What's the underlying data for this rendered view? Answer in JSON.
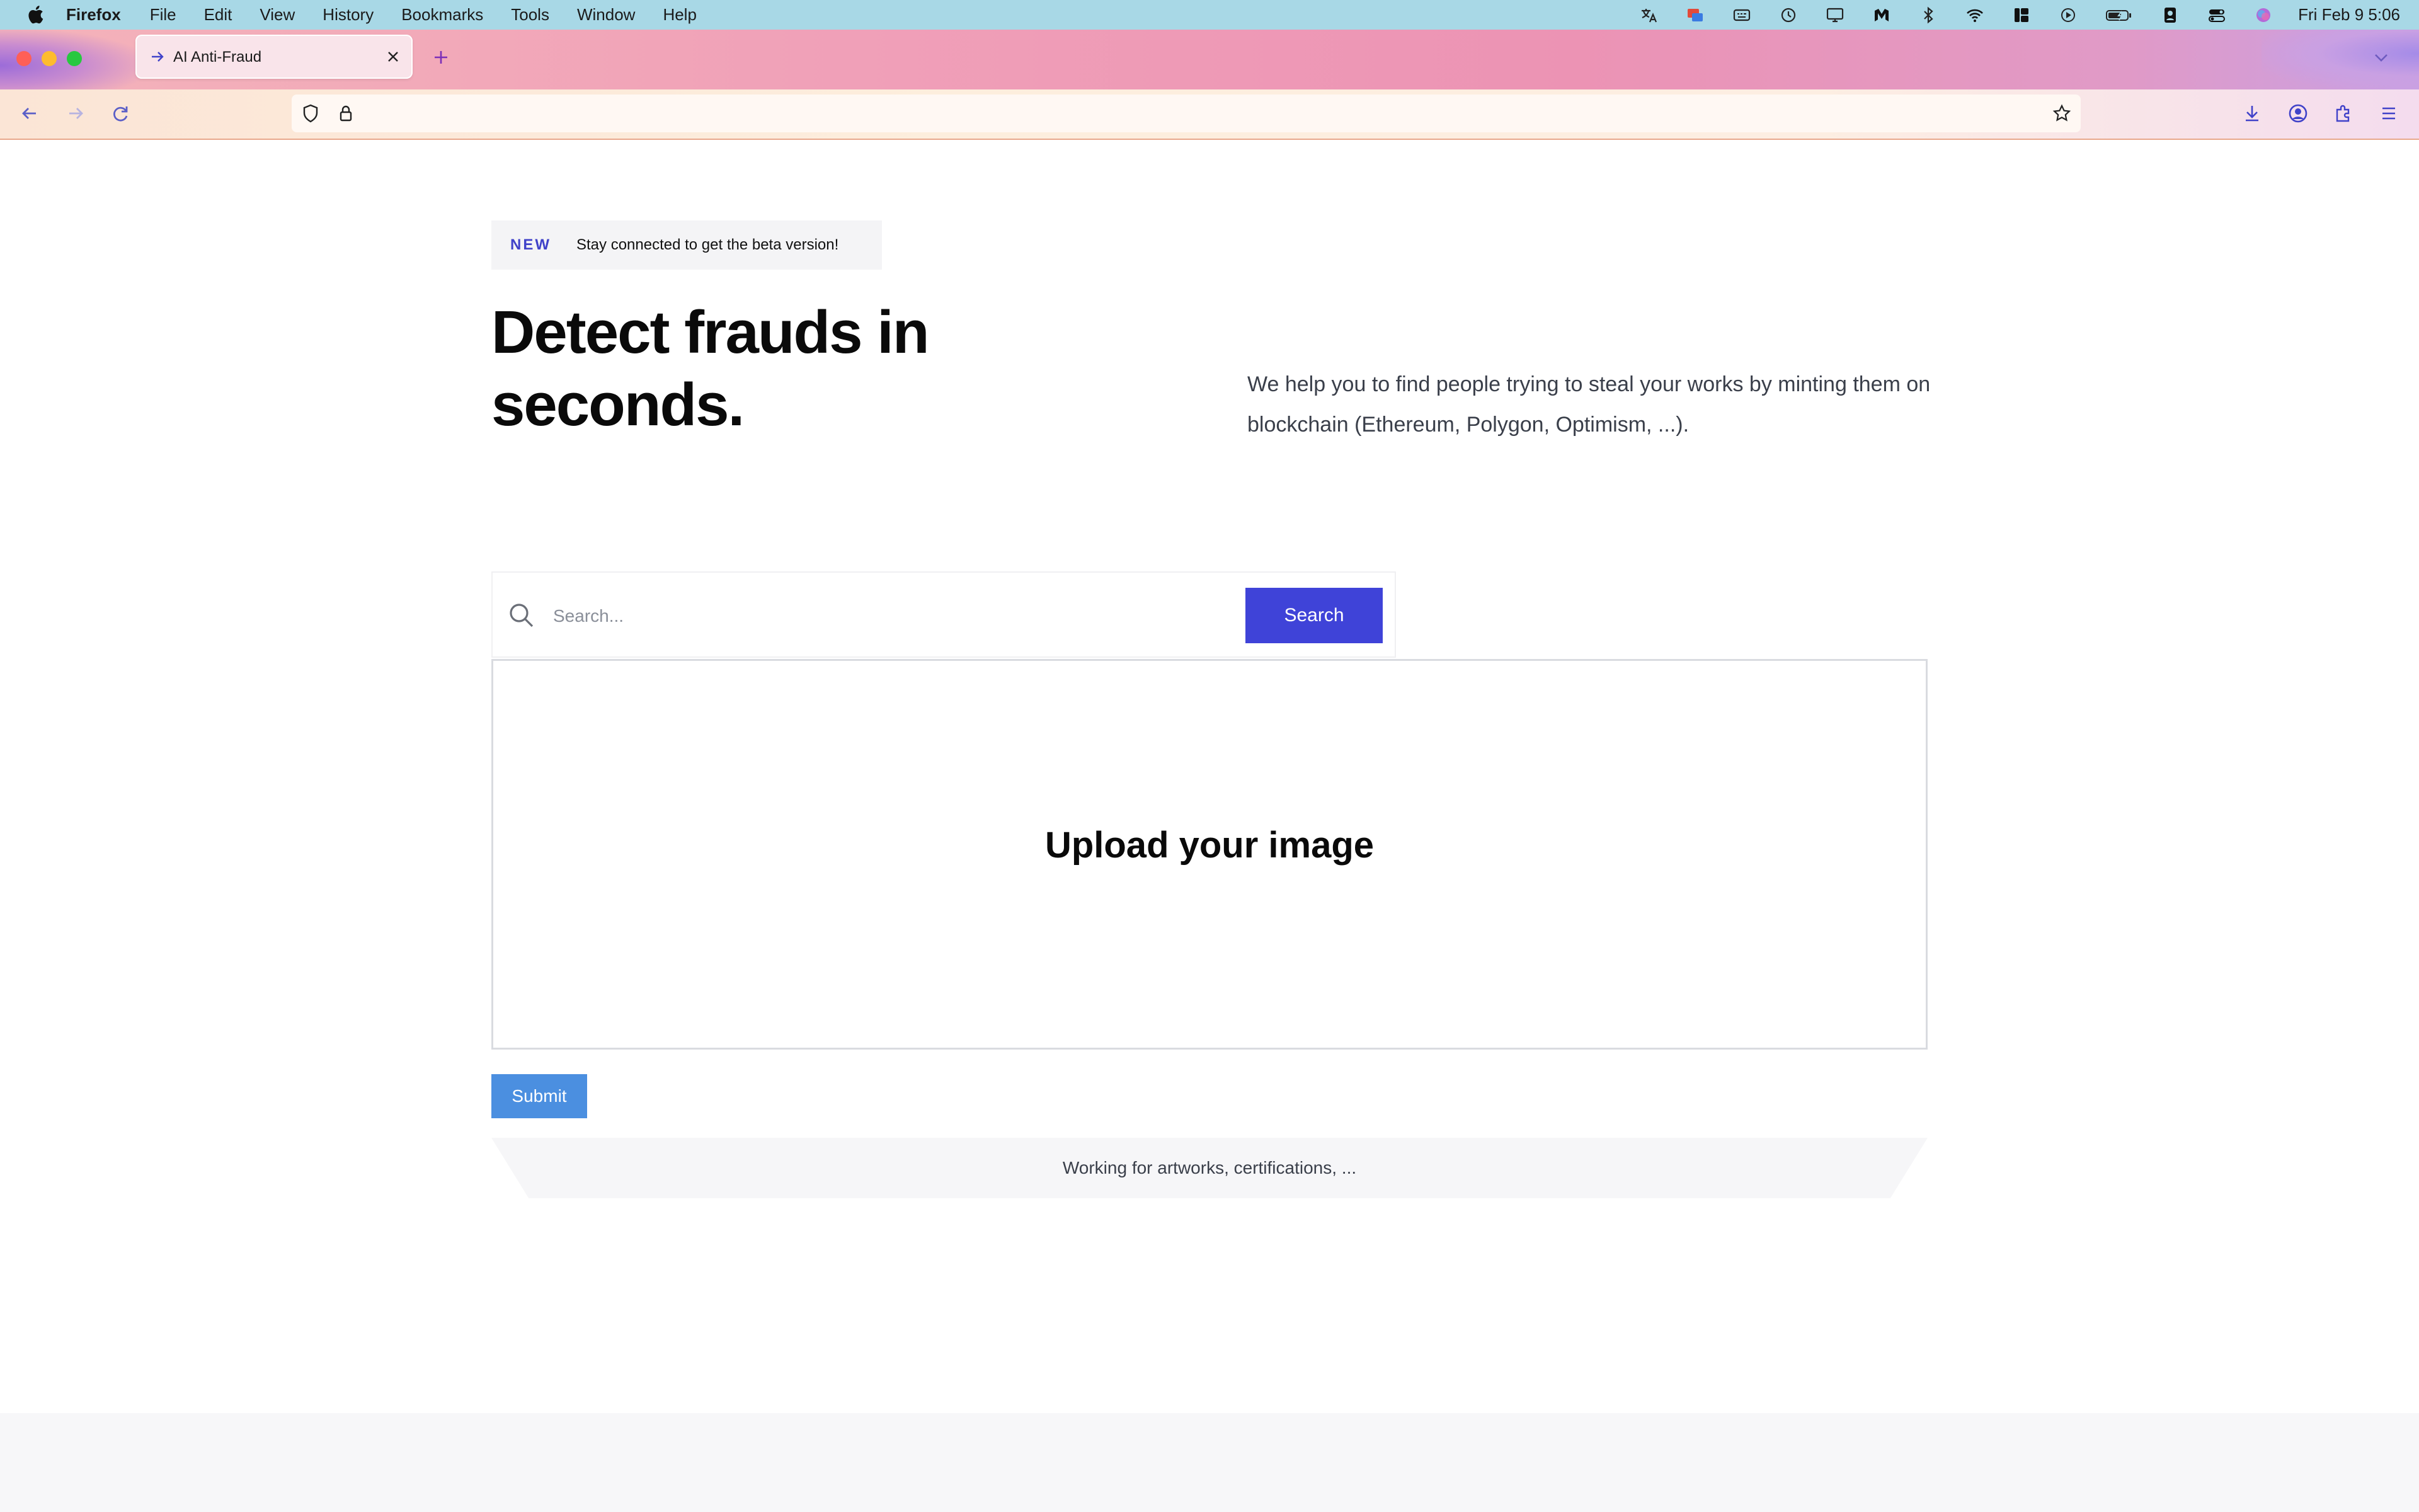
{
  "menubar": {
    "app_name": "Firefox",
    "menus": [
      "File",
      "Edit",
      "View",
      "History",
      "Bookmarks",
      "Tools",
      "Window",
      "Help"
    ],
    "clock": "Fri Feb 9  5:06",
    "status_icons": [
      "translate-icon",
      "screen-share-icon",
      "input-source-icon",
      "time-machine-icon",
      "display-icon",
      "malwarebytes-icon",
      "bluetooth-icon",
      "wifi-icon",
      "stage-manager-icon",
      "play-icon",
      "battery-icon",
      "user-icon",
      "control-center-icon",
      "siri-icon"
    ]
  },
  "browser": {
    "tab": {
      "title": "AI Anti-Fraud"
    },
    "url": ""
  },
  "hero": {
    "badge_tag": "NEW",
    "badge_text": "Stay connected to get the beta version!",
    "title_line1": "Detect frauds in",
    "title_line2": "seconds.",
    "description": "We help you to find people trying to steal your works by minting them on blockchain (Ethereum, Polygon, Optimism, ...)."
  },
  "search": {
    "placeholder": "Search...",
    "value": "",
    "button_label": "Search"
  },
  "upload": {
    "label": "Upload your image"
  },
  "submit": {
    "label": "Submit"
  },
  "footer": {
    "note": "Working for artworks, certifications, ..."
  },
  "colors": {
    "accent": "#3f43d8",
    "submit": "#4b8fe0",
    "badge_tag": "#4042c9"
  }
}
